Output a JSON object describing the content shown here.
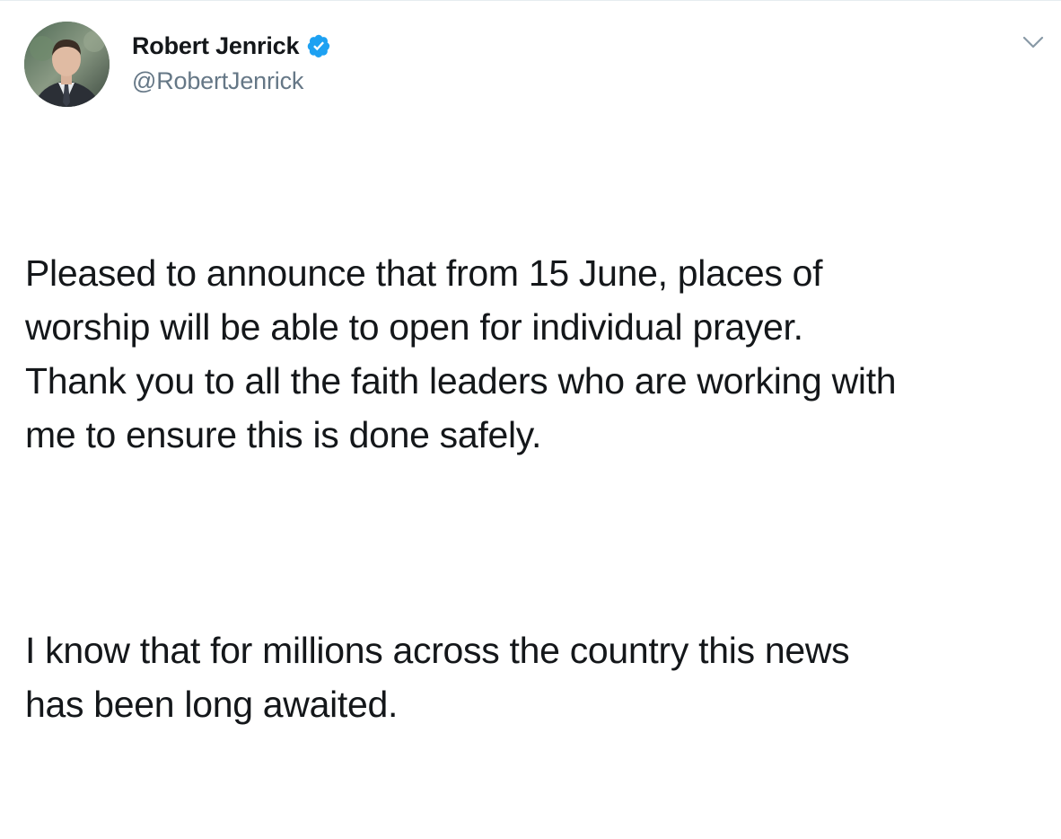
{
  "author": {
    "display_name": "Robert Jenrick",
    "handle": "@RobertJenrick",
    "verified": true,
    "verified_icon": "verified-badge-icon",
    "verified_color": "#1da1f2"
  },
  "tweet": {
    "paragraphs": [
      "Pleased to announce that from 15 June, places of\nworship will be able to open for individual prayer.\nThank you to all the faith leaders who are working with\nme to ensure this is done safely.",
      "I know that for millions across the country this news\nhas been long awaited."
    ]
  },
  "menu": {
    "icon": "chevron-down-icon"
  }
}
